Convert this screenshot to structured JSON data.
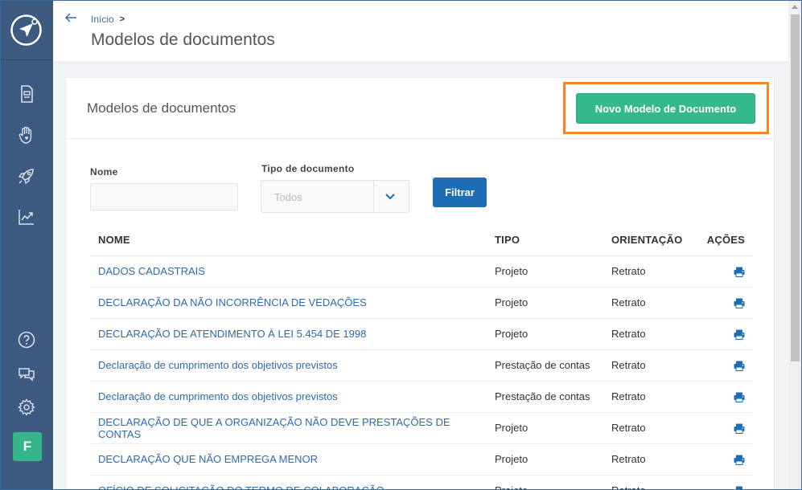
{
  "sidebar": {
    "nav": [
      {
        "icon": "document-icon"
      },
      {
        "icon": "hand-heart-icon"
      },
      {
        "icon": "rocket-icon"
      },
      {
        "icon": "chart-icon"
      }
    ],
    "bottom": [
      {
        "icon": "help-icon"
      },
      {
        "icon": "chat-icon"
      },
      {
        "icon": "gear-icon"
      }
    ],
    "avatar_letter": "F",
    "avatar_color": "#36b58b",
    "bg_color": "#3d5a80"
  },
  "header": {
    "breadcrumb": "Início",
    "title": "Modelos de documentos"
  },
  "card": {
    "title": "Modelos de documentos",
    "new_button": "Novo Modelo de Documento",
    "highlight_color": "#f5862a",
    "accent_color": "#35b88c"
  },
  "filters": {
    "nome_label": "Nome",
    "nome_value": "",
    "tipo_label": "Tipo de documento",
    "tipo_value": "Todos",
    "filter_button": "Filtrar"
  },
  "table": {
    "headers": [
      "NOME",
      "TIPO",
      "ORIENTAÇÃO",
      "AÇÕES"
    ],
    "rows": [
      {
        "nome": "DADOS CADASTRAIS",
        "tipo": "Projeto",
        "orientacao": "Retrato"
      },
      {
        "nome": "DECLARAÇÃO DA NÃO INCORRÊNCIA DE VEDAÇÕES",
        "tipo": "Projeto",
        "orientacao": "Retrato"
      },
      {
        "nome": "DECLARAÇÃO DE ATENDIMENTO À LEI 5.454 DE 1998",
        "tipo": "Projeto",
        "orientacao": "Retrato"
      },
      {
        "nome": "Declaração de cumprimento dos objetivos previstos",
        "tipo": "Prestação de contas",
        "orientacao": "Retrato"
      },
      {
        "nome": "Declaração de cumprimento dos objetivos previstos",
        "tipo": "Prestação de contas",
        "orientacao": "Retrato"
      },
      {
        "nome": "DECLARAÇÃO DE QUE A ORGANIZAÇÃO NÃO DEVE PRESTAÇÕES DE CONTAS",
        "tipo": "Projeto",
        "orientacao": "Retrato"
      },
      {
        "nome": "DECLARAÇÃO QUE NÃO EMPREGA MENOR",
        "tipo": "Projeto",
        "orientacao": "Retrato"
      },
      {
        "nome": "OFÍCIO DE SOLICITAÇÃO DO TERMO DE COLABORAÇÃO",
        "tipo": "Projeto",
        "orientacao": "Retrato"
      }
    ]
  }
}
